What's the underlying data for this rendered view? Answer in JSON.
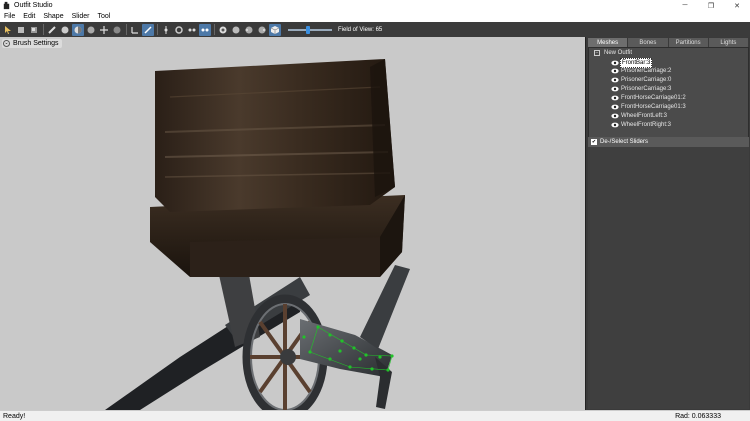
{
  "window": {
    "title": "Outfit Studio",
    "minimize": "─",
    "maximize": "❐",
    "close": "✕"
  },
  "menu": [
    "File",
    "Edit",
    "Shape",
    "Slider",
    "Tool"
  ],
  "toolbar": {
    "fov_label": "Field of View: 65",
    "fov_level": 0.45,
    "accent": "#4d79a8"
  },
  "viewport": {
    "brush_settings_label": "Brush Settings",
    "background": "#c9c9c9"
  },
  "panel": {
    "tabs": [
      "Meshes",
      "Bones",
      "Partitions",
      "Lights"
    ],
    "active_tab": "Meshes",
    "root_label": "New Outfit",
    "meshes": [
      "FrontBar:3",
      "PrisonerCarriage:2",
      "PrisonerCarriage:0",
      "PrisonerCarriage:3",
      "FrontHorseCarriage01:2",
      "FrontHorseCarriage01:3",
      "WheelFrontLeft:3",
      "WheelFrontRight:3"
    ],
    "selected_mesh": "FrontBar:3",
    "sliders_toggle_label": "De-/Select Sliders"
  },
  "status": {
    "left": "Ready!",
    "right": "Rad: 0.063333"
  }
}
